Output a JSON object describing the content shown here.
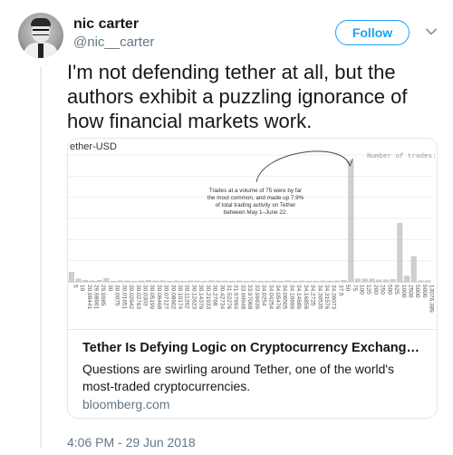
{
  "tweet": {
    "display_name": "nic carter",
    "handle": "@nic__carter",
    "follow_label": "Follow",
    "text": "I'm not defending tether at all, but the authors exhibit a puzzling ignorance of how financial markets work.",
    "timestamp": "4:06 PM - 29 Jun 2018"
  },
  "card": {
    "title": "Tether Is Defying Logic on Cryptocurrency Exchang…",
    "description": "Questions are swirling around Tether, one of the world's most-traded cryptocurrencies.",
    "domain": "bloomberg.com"
  },
  "chart_data": {
    "type": "bar",
    "title": "ether-USD",
    "legend": "Number of trades",
    "annotation": [
      "Trades at a volume of 75 were by far",
      "the most common, and made up 7.9%",
      "of total trading activity on Tether",
      "between May 1–June 22."
    ],
    "categories": [
      "5",
      "10",
      "20.98441",
      "29.98661",
      "29.9985",
      "30",
      "30.0075",
      "30.01651",
      "30.02642",
      "30.02763",
      "30.0303",
      "30.05199",
      "30.06468",
      "30.07127",
      "30.08602",
      "30.10174",
      "30.11262",
      "30.12623",
      "30.14376",
      "30.21933",
      "30.2768",
      "30.42734",
      "31.52276",
      "31.97694",
      "33.90948",
      "33.97068",
      "33.99639",
      "34.0254",
      "34.04254",
      "34.05476",
      "34.06505",
      "34.10699",
      "34.14689",
      "34.16856",
      "34.2725",
      "34.30535",
      "34.31576",
      "34.36073",
      "37.5",
      "50",
      "75",
      "100",
      "125",
      "200",
      "250",
      "500",
      "925",
      "1000",
      "2500",
      "5000",
      "9000",
      "13076.389"
    ],
    "values": [
      5,
      1.5,
      0.8,
      0.5,
      0.8,
      1.8,
      0.4,
      0.6,
      0.5,
      0.4,
      0.5,
      0.8,
      0.5,
      0.6,
      0.4,
      0.5,
      0.4,
      0.5,
      0.5,
      0.4,
      0.6,
      0.5,
      0.5,
      0.4,
      0.5,
      0.4,
      0.5,
      0.4,
      0.4,
      0.5,
      0.4,
      0.6,
      0.4,
      0.5,
      0.4,
      0.4,
      0.5,
      0.4,
      0.5,
      0.8,
      62,
      1.5,
      1.5,
      1.5,
      1.0,
      1.0,
      1.2,
      30,
      3,
      13,
      0.6,
      0.6
    ],
    "ylim": [
      0,
      65
    ],
    "grid": true
  }
}
